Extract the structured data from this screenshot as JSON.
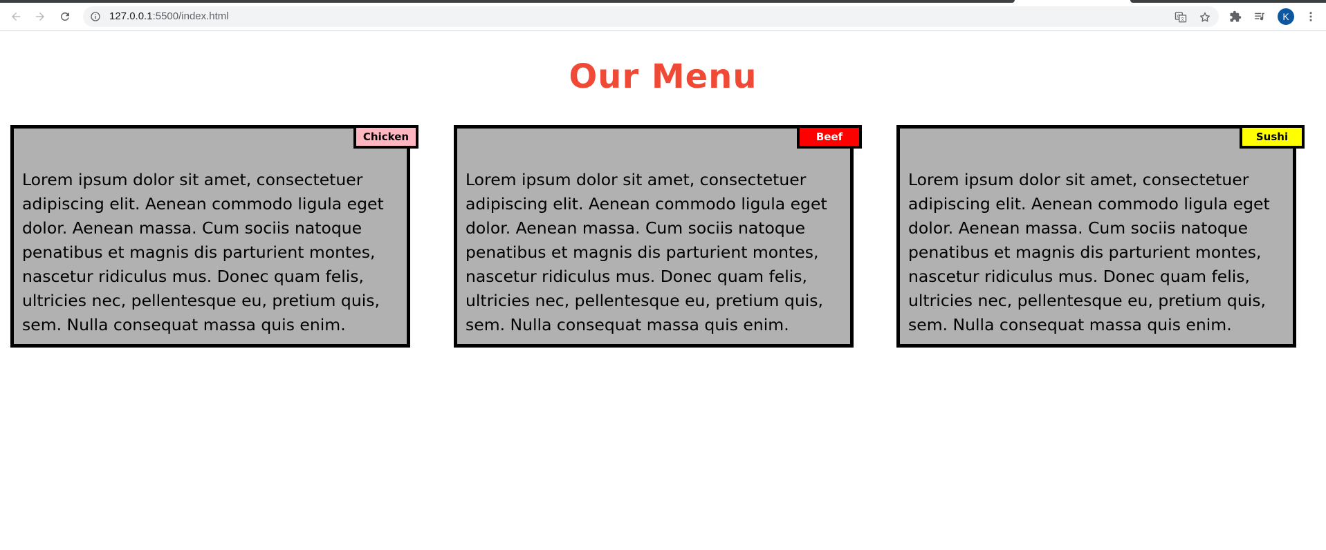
{
  "browser": {
    "url_host": "127.0.0.1",
    "url_path": ":5500/index.html",
    "avatar_letter": "K",
    "icons": [
      "back-arrow-icon",
      "forward-arrow-icon",
      "reload-icon",
      "site-info-icon",
      "translate-icon",
      "bookmark-star-icon",
      "extensions-puzzle-icon",
      "media-queue-icon",
      "profile-avatar",
      "more-menu-icon"
    ]
  },
  "page": {
    "title": "Our Menu",
    "title_color": "#f04a36",
    "cards": [
      {
        "tag": "Chicken",
        "tag_bg": "#ffb6c1",
        "tag_color": "#000000",
        "text": "Lorem ipsum dolor sit amet, consectetuer adipiscing elit. Aenean commodo ligula eget dolor. Aenean massa. Cum sociis natoque penatibus et magnis dis parturient montes, nascetur ridiculus mus. Donec quam felis, ultricies nec, pellentesque eu, pretium quis, sem. Nulla consequat massa quis enim."
      },
      {
        "tag": "Beef",
        "tag_bg": "#ff0000",
        "tag_color": "#ffffff",
        "text": "Lorem ipsum dolor sit amet, consectetuer adipiscing elit. Aenean commodo ligula eget dolor. Aenean massa. Cum sociis natoque penatibus et magnis dis parturient montes, nascetur ridiculus mus. Donec quam felis, ultricies nec, pellentesque eu, pretium quis, sem. Nulla consequat massa quis enim."
      },
      {
        "tag": "Sushi",
        "tag_bg": "#ffff00",
        "tag_color": "#000000",
        "text": "Lorem ipsum dolor sit amet, consectetuer adipiscing elit. Aenean commodo ligula eget dolor. Aenean massa. Cum sociis natoque penatibus et magnis dis parturient montes, nascetur ridiculus mus. Donec quam felis, ultricies nec, pellentesque eu, pretium quis, sem. Nulla consequat massa quis enim."
      }
    ],
    "card_bg": "#b1b1b1"
  }
}
